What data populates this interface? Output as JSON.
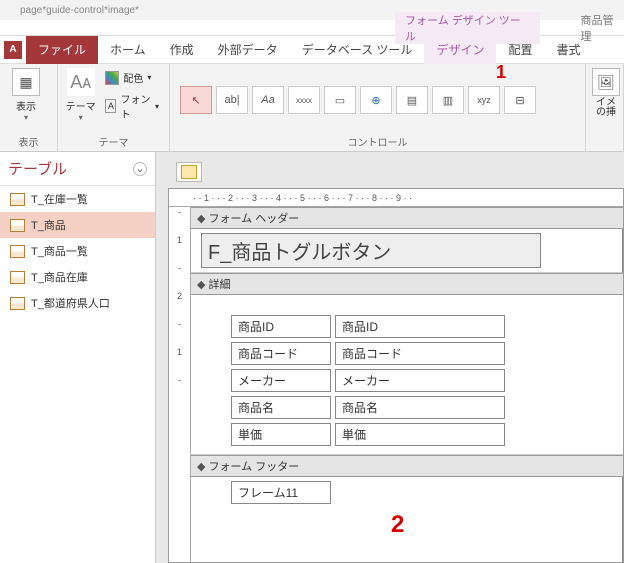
{
  "title_bar": {
    "doc_caption": "page*guide-control*image*"
  },
  "context_tools": {
    "label": "フォーム デザイン ツール"
  },
  "app_name": "商品管理",
  "tabs": {
    "file": "ファイル",
    "home": "ホーム",
    "create": "作成",
    "external": "外部データ",
    "dbtools": "データベース ツール",
    "design": "デザイン",
    "arrange": "配置",
    "format": "書式"
  },
  "ribbon": {
    "view_label": "表示",
    "theme_label": "テーマ",
    "colors_label": "配色",
    "fonts_label": "フォント",
    "theme_group": "テーマ",
    "controls_group": "コントロール",
    "image_insert": "イメ\nの挿",
    "ctrl_ab": "ab|",
    "ctrl_aa": "Aa",
    "ctrl_xxxx": "xxxx",
    "ctrl_xyz": "xyz"
  },
  "annotations": {
    "one": "1",
    "two": "2"
  },
  "nav": {
    "header": "テーブル",
    "items": [
      "T_在庫一覧",
      "T_商品",
      "T_商品一覧",
      "T_商品在庫",
      "T_都道府県人口"
    ],
    "selected_index": 1
  },
  "ruler": "· · 1 · · · 2 · · · 3 · · · 4 · · · 5 · · · 6 · · · 7 · · · 8 · · · 9 · ·",
  "form": {
    "section_header": "フォーム ヘッダー",
    "title": "F_商品トグルボタン",
    "section_detail": "詳細",
    "fields": [
      {
        "label": "商品ID",
        "value": "商品ID"
      },
      {
        "label": "商品コード",
        "value": "商品コード"
      },
      {
        "label": "メーカー",
        "value": "メーカー"
      },
      {
        "label": "商品名",
        "value": "商品名"
      },
      {
        "label": "単価",
        "value": "単価"
      }
    ],
    "section_footer": "フォーム フッター",
    "frame_label": "フレーム11"
  }
}
